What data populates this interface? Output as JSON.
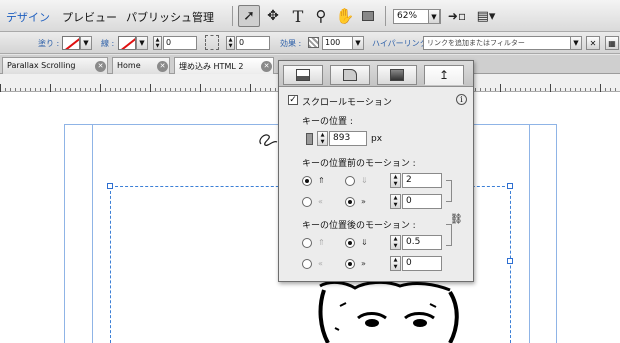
{
  "menubar": {
    "items": [
      "デザイン",
      "プレビュー",
      "パブリッシュ",
      "管理"
    ],
    "zoom": "62%"
  },
  "propbar": {
    "fill_label": "塗り :",
    "stroke_label": "線 :",
    "stroke_width": "0",
    "corner_radius": "0",
    "effect_label": "効果 :",
    "opacity": "100",
    "hyperlink_label": "ハイパーリンク :",
    "hyperlink_placeholder": "リンクを追加またはフィルター"
  },
  "tabs": [
    {
      "label": "Parallax Scrolling"
    },
    {
      "label": "Home"
    },
    {
      "label": "埋め込み HTML 2"
    }
  ],
  "panel": {
    "scroll_motion_label": "スクロールモーション",
    "scroll_motion_checked": true,
    "key_position_label": "キーの位置 :",
    "key_position_value": "893",
    "key_position_unit": "px",
    "before_label": "キーの位置前のモーション :",
    "before_vertical": "2",
    "before_horizontal": "0",
    "after_label": "キーの位置後のモーション :",
    "after_vertical": "0.5",
    "after_horizontal": "0"
  },
  "colors": {
    "accent": "#1f5fbf",
    "guide": "#8fb4e6",
    "selection": "#3c7fd6"
  }
}
